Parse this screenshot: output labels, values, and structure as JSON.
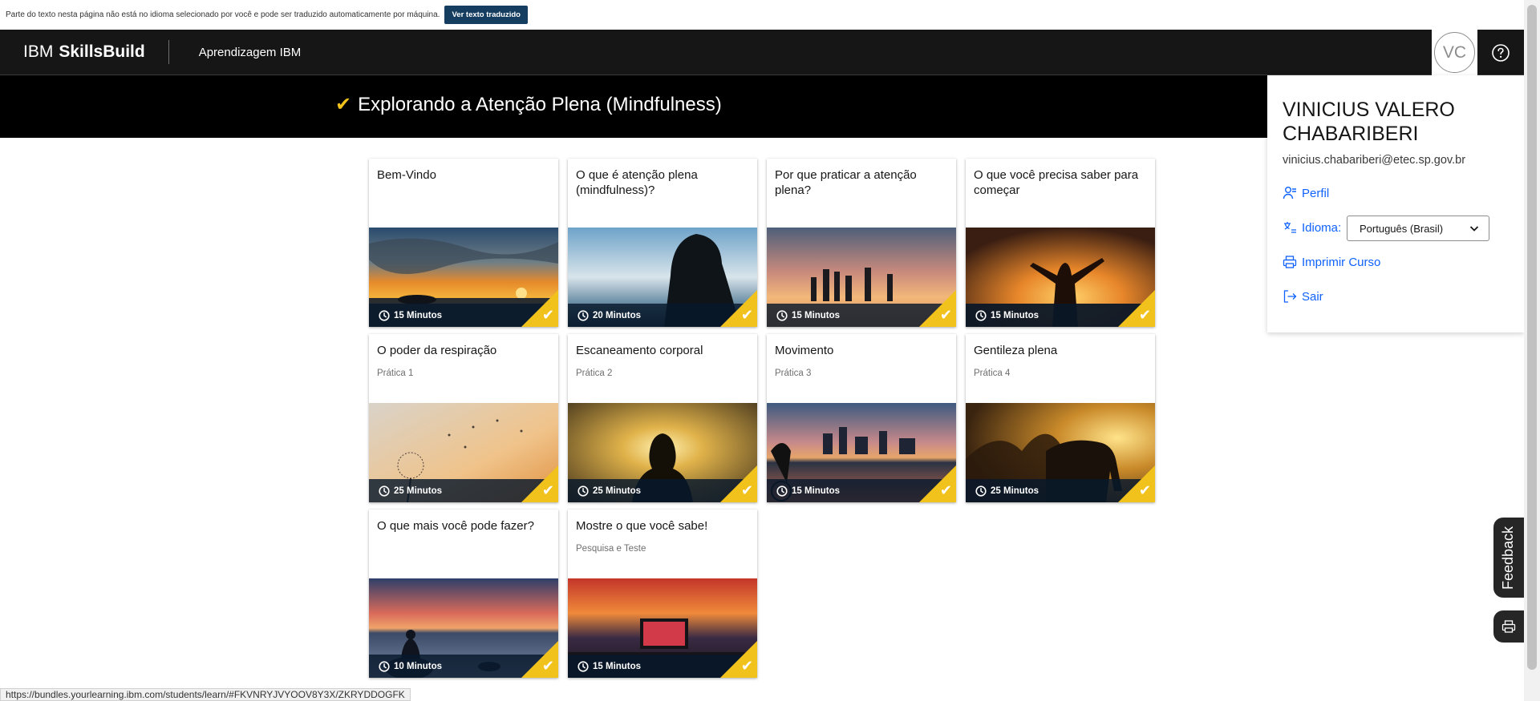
{
  "notice": {
    "text": "Parte do texto nesta página não está no idioma selecionado por você e pode ser traduzido automaticamente por máquina.",
    "button_label": "Ver texto traduzido"
  },
  "header": {
    "brand_prefix": "IBM",
    "brand_name": "SkillsBuild",
    "nav_link": "Aprendizagem IBM",
    "avatar_initials": "VC"
  },
  "course": {
    "title": "Explorando a Atenção Plena (Mindfulness)",
    "completed": true
  },
  "cards": [
    {
      "title": "Bem-Vindo",
      "subtitle": "",
      "duration": "15 Minutos",
      "completed": true
    },
    {
      "title": "O que é atenção plena (mindfulness)?",
      "subtitle": "",
      "duration": "20 Minutos",
      "completed": true
    },
    {
      "title": "Por que praticar a atenção plena?",
      "subtitle": "",
      "duration": "15 Minutos",
      "completed": true
    },
    {
      "title": "O que você precisa saber para começar",
      "subtitle": "",
      "duration": "15 Minutos",
      "completed": true
    },
    {
      "title": "O poder da respiração",
      "subtitle": "Prática 1",
      "duration": "25 Minutos",
      "completed": true
    },
    {
      "title": "Escaneamento corporal",
      "subtitle": "Prática 2",
      "duration": "25 Minutos",
      "completed": true
    },
    {
      "title": "Movimento",
      "subtitle": "Prática 3",
      "duration": "15 Minutos",
      "completed": true
    },
    {
      "title": "Gentileza plena",
      "subtitle": "Prática 4",
      "duration": "25 Minutos",
      "completed": true
    },
    {
      "title": "O que mais você pode fazer?",
      "subtitle": "",
      "duration": "10 Minutos",
      "completed": true
    },
    {
      "title": "Mostre o que você sabe!",
      "subtitle": "Pesquisa e Teste",
      "duration": "15 Minutos",
      "completed": true
    }
  ],
  "profile": {
    "name": "VINICIUS VALERO CHABARIBERI",
    "email": "vinicius.chabariberi@etec.sp.gov.br",
    "profile_link": "Perfil",
    "language_label": "Idioma:",
    "language_value": "Português (Brasil)",
    "print_link": "Imprimir Curso",
    "logout_link": "Sair"
  },
  "feedback_label": "Feedback",
  "status_url": "https://bundles.yourlearning.ibm.com/students/learn/#FKVNRYJVYOOV8Y3X/ZKRYDDOGFK",
  "colors": {
    "accent_yellow": "#f1c21b",
    "link_blue": "#0f62fe",
    "header_bg": "#161616",
    "notice_button_bg": "#143d60"
  }
}
